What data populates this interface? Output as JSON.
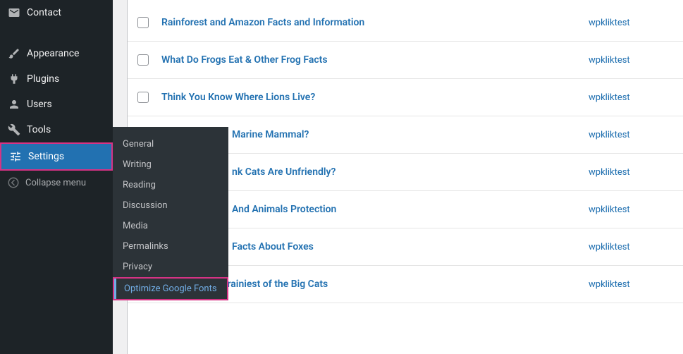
{
  "sidebar": {
    "items": [
      {
        "label": "Contact"
      },
      {
        "label": "Appearance"
      },
      {
        "label": "Plugins"
      },
      {
        "label": "Users"
      },
      {
        "label": "Tools"
      },
      {
        "label": "Settings"
      }
    ],
    "collapse_label": "Collapse menu"
  },
  "submenu": {
    "items": [
      "General",
      "Writing",
      "Reading",
      "Discussion",
      "Media",
      "Permalinks",
      "Privacy",
      "Optimize Google Fonts"
    ]
  },
  "posts": [
    {
      "title": "Rainforest and Amazon Facts and Information",
      "author": "wpkliktest"
    },
    {
      "title": "What Do Frogs Eat & Other Frog Facts",
      "author": "wpkliktest"
    },
    {
      "title": "Think You Know Where Lions Live?",
      "author": "wpkliktest"
    },
    {
      "title": "Marine Mammal?",
      "author": "wpkliktest"
    },
    {
      "title": "nk Cats Are Unfriendly?",
      "author": "wpkliktest"
    },
    {
      "title": "And Animals Protection",
      "author": "wpkliktest"
    },
    {
      "title": "Facts About Foxes",
      "author": "wpkliktest"
    },
    {
      "title": "Lions are the Brainiest of the Big Cats",
      "author": "wpkliktest"
    }
  ],
  "highlight_color": "#d63384",
  "link_color": "#2271b1"
}
